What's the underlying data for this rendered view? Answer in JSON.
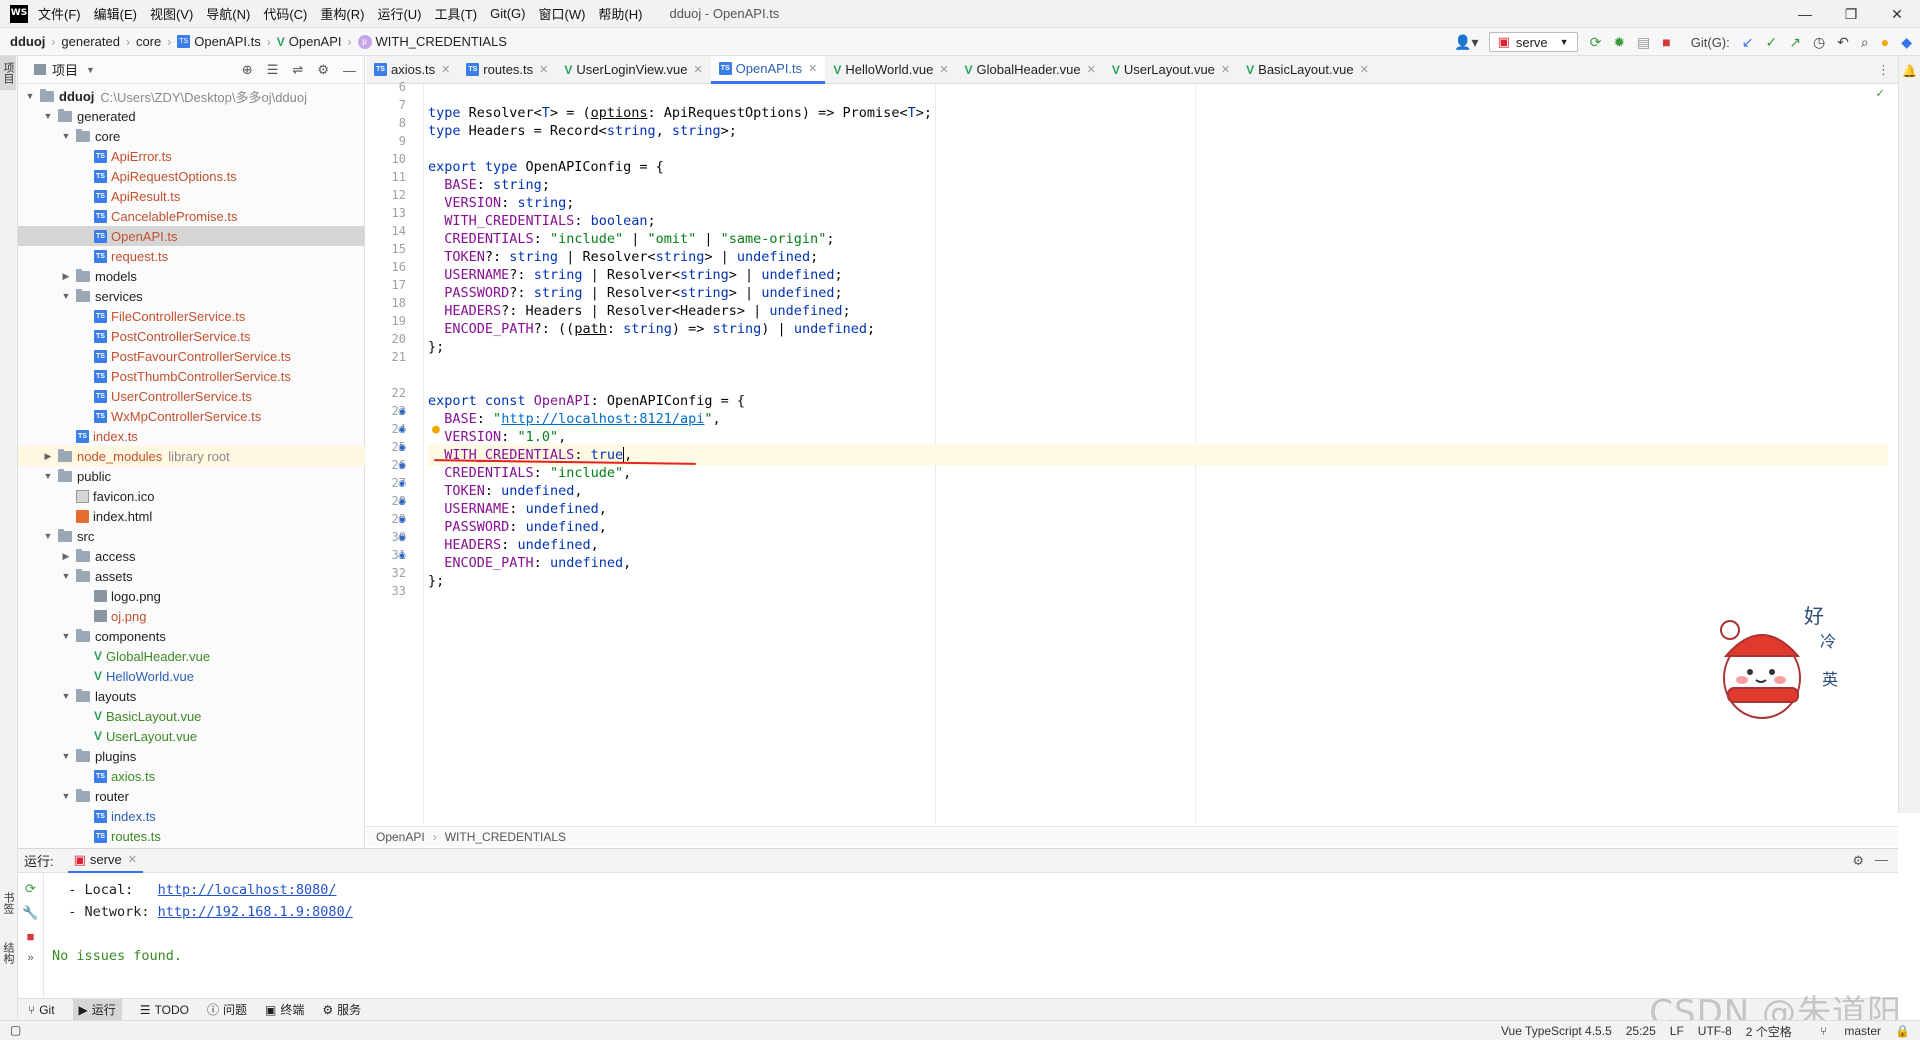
{
  "titlebar": {
    "logo": "WS",
    "menu": [
      "文件(F)",
      "编辑(E)",
      "视图(V)",
      "导航(N)",
      "代码(C)",
      "重构(R)",
      "运行(U)",
      "工具(T)",
      "Git(G)",
      "窗口(W)",
      "帮助(H)"
    ],
    "window_title": "dduoj - OpenAPI.ts",
    "minimize": "—",
    "restore": "❐",
    "close": "✕"
  },
  "navbar": {
    "crumbs": [
      "dduoj",
      "generated",
      "core",
      "OpenAPI.ts",
      "OpenAPI",
      "WITH_CREDENTIALS"
    ],
    "run_config": "serve",
    "git_label": "Git(G):"
  },
  "leftstripe": {
    "project": "项目",
    "bookmarks": "书签",
    "structure": "结构"
  },
  "project": {
    "header": "项目",
    "tree": [
      {
        "label": "dduoj",
        "extra": "C:\\Users\\ZDY\\Desktop\\多多oj\\dduoj",
        "depth": 0,
        "kind": "folder",
        "open": true,
        "color": "dark"
      },
      {
        "label": "generated",
        "depth": 1,
        "kind": "folder",
        "open": true,
        "color": "dark"
      },
      {
        "label": "core",
        "depth": 2,
        "kind": "folder",
        "open": true,
        "color": "dark"
      },
      {
        "label": "ApiError.ts",
        "depth": 3,
        "kind": "ts",
        "color": "red"
      },
      {
        "label": "ApiRequestOptions.ts",
        "depth": 3,
        "kind": "ts",
        "color": "red"
      },
      {
        "label": "ApiResult.ts",
        "depth": 3,
        "kind": "ts",
        "color": "red"
      },
      {
        "label": "CancelablePromise.ts",
        "depth": 3,
        "kind": "ts",
        "color": "red"
      },
      {
        "label": "OpenAPI.ts",
        "depth": 3,
        "kind": "ts",
        "color": "red",
        "selected": true
      },
      {
        "label": "request.ts",
        "depth": 3,
        "kind": "ts",
        "color": "red"
      },
      {
        "label": "models",
        "depth": 2,
        "kind": "folder",
        "open": false,
        "color": "dark"
      },
      {
        "label": "services",
        "depth": 2,
        "kind": "folder",
        "open": true,
        "color": "dark"
      },
      {
        "label": "FileControllerService.ts",
        "depth": 3,
        "kind": "ts",
        "color": "red"
      },
      {
        "label": "PostControllerService.ts",
        "depth": 3,
        "kind": "ts",
        "color": "red"
      },
      {
        "label": "PostFavourControllerService.ts",
        "depth": 3,
        "kind": "ts",
        "color": "red"
      },
      {
        "label": "PostThumbControllerService.ts",
        "depth": 3,
        "kind": "ts",
        "color": "red"
      },
      {
        "label": "UserControllerService.ts",
        "depth": 3,
        "kind": "ts",
        "color": "red"
      },
      {
        "label": "WxMpControllerService.ts",
        "depth": 3,
        "kind": "ts",
        "color": "red"
      },
      {
        "label": "index.ts",
        "depth": 2,
        "kind": "ts",
        "color": "red"
      },
      {
        "label": "node_modules",
        "extra": "library root",
        "depth": 1,
        "kind": "folder",
        "open": false,
        "color": "red",
        "lib": true
      },
      {
        "label": "public",
        "depth": 1,
        "kind": "folder",
        "open": true,
        "color": "dark"
      },
      {
        "label": "favicon.ico",
        "depth": 2,
        "kind": "icofile",
        "color": "dark"
      },
      {
        "label": "index.html",
        "depth": 2,
        "kind": "html",
        "color": "dark"
      },
      {
        "label": "src",
        "depth": 1,
        "kind": "folder",
        "open": true,
        "color": "dark"
      },
      {
        "label": "access",
        "depth": 2,
        "kind": "folder",
        "open": false,
        "color": "dark"
      },
      {
        "label": "assets",
        "depth": 2,
        "kind": "folder",
        "open": true,
        "color": "dark"
      },
      {
        "label": "logo.png",
        "depth": 3,
        "kind": "img",
        "color": "dark"
      },
      {
        "label": "oj.png",
        "depth": 3,
        "kind": "img",
        "color": "red"
      },
      {
        "label": "components",
        "depth": 2,
        "kind": "folder",
        "open": true,
        "color": "dark"
      },
      {
        "label": "GlobalHeader.vue",
        "depth": 3,
        "kind": "vue",
        "color": "green"
      },
      {
        "label": "HelloWorld.vue",
        "depth": 3,
        "kind": "vue",
        "color": "blue"
      },
      {
        "label": "layouts",
        "depth": 2,
        "kind": "folder",
        "open": true,
        "color": "dark"
      },
      {
        "label": "BasicLayout.vue",
        "depth": 3,
        "kind": "vue",
        "color": "green"
      },
      {
        "label": "UserLayout.vue",
        "depth": 3,
        "kind": "vue",
        "color": "green"
      },
      {
        "label": "plugins",
        "depth": 2,
        "kind": "folder",
        "open": true,
        "color": "dark"
      },
      {
        "label": "axios.ts",
        "depth": 3,
        "kind": "ts",
        "color": "green"
      },
      {
        "label": "router",
        "depth": 2,
        "kind": "folder",
        "open": true,
        "color": "dark"
      },
      {
        "label": "index.ts",
        "depth": 3,
        "kind": "ts",
        "color": "blue"
      },
      {
        "label": "routes.ts",
        "depth": 3,
        "kind": "ts",
        "color": "green"
      }
    ]
  },
  "tabs": [
    {
      "label": "axios.ts",
      "kind": "ts"
    },
    {
      "label": "routes.ts",
      "kind": "ts"
    },
    {
      "label": "UserLoginView.vue",
      "kind": "vue"
    },
    {
      "label": "OpenAPI.ts",
      "kind": "ts",
      "active": true
    },
    {
      "label": "HelloWorld.vue",
      "kind": "vue"
    },
    {
      "label": "GlobalHeader.vue",
      "kind": "vue"
    },
    {
      "label": "UserLayout.vue",
      "kind": "vue"
    },
    {
      "label": "BasicLayout.vue",
      "kind": "vue"
    }
  ],
  "editor": {
    "line_numbers": [
      "6",
      "7",
      "8",
      "9",
      "10",
      "11",
      "12",
      "13",
      "14",
      "15",
      "16",
      "17",
      "18",
      "19",
      "20",
      "21",
      "",
      "22",
      "23",
      "24",
      "25",
      "26",
      "27",
      "28",
      "29",
      "30",
      "31",
      "32",
      "33"
    ],
    "current_line": 25,
    "breadcrumb": [
      "OpenAPI",
      "WITH_CREDENTIALS"
    ]
  },
  "run": {
    "label": "运行:",
    "config": "serve",
    "output": [
      {
        "prefix": "  - Local:   ",
        "link": "http://localhost:8080/"
      },
      {
        "prefix": "  - Network: ",
        "link": "http://192.168.1.9:8080/"
      },
      {
        "prefix": "",
        "link": ""
      },
      {
        "prefix": "No issues found.",
        "link": ""
      }
    ]
  },
  "bottombar": [
    "Git",
    "运行",
    "TODO",
    "问题",
    "终端",
    "服务"
  ],
  "statusbar": {
    "lang": "Vue TypeScript 4.5.5",
    "pos": "25:25",
    "eol": "LF",
    "enc": "UTF-8",
    "indent": "2 个空格",
    "branch": "master"
  },
  "sticker": {
    "chars": [
      "好",
      "冷",
      "英"
    ]
  },
  "watermark": "CSDN @朱道阳",
  "colors": {
    "accent": "#3574f0",
    "keyword": "#0033b3",
    "string": "#067d17",
    "property": "#871094",
    "annotation": "#e52222"
  }
}
